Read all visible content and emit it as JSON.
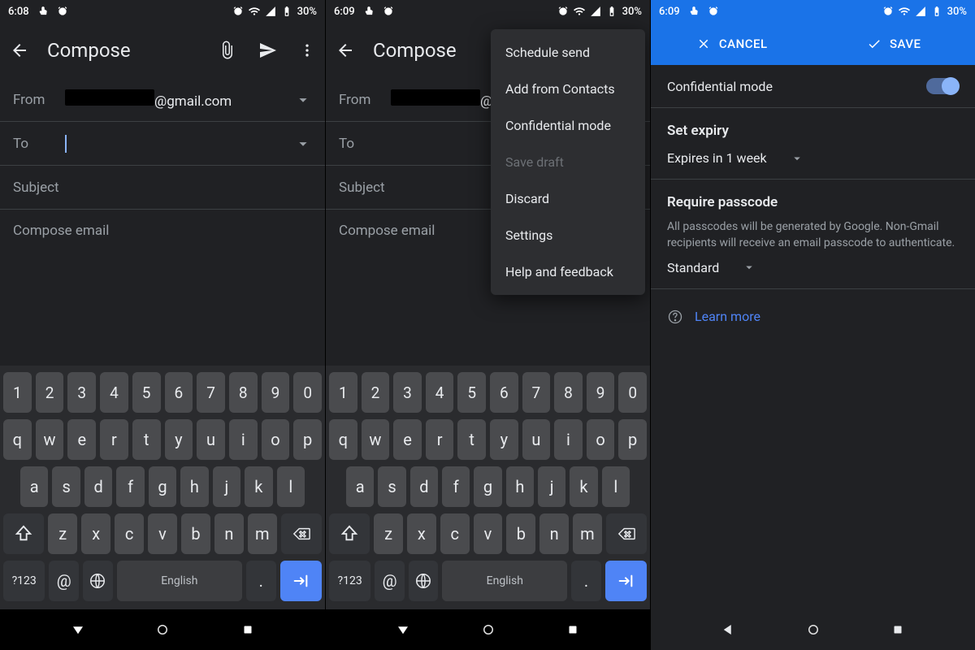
{
  "status": {
    "time_a": "6:08",
    "time_b": "6:09",
    "time_c": "6:09",
    "battery": "30%"
  },
  "compose": {
    "title": "Compose",
    "from_label": "From",
    "from_tail": "@gmail.com",
    "to_label": "To",
    "subject_placeholder": "Subject",
    "body_placeholder": "Compose email"
  },
  "menu": {
    "items": [
      "Schedule send",
      "Add from Contacts",
      "Confidential mode",
      "Save draft",
      "Discard",
      "Settings",
      "Help and feedback"
    ],
    "disabled_index": 3
  },
  "keyboard": {
    "row_num": [
      "1",
      "2",
      "3",
      "4",
      "5",
      "6",
      "7",
      "8",
      "9",
      "0"
    ],
    "row1": [
      "q",
      "w",
      "e",
      "r",
      "t",
      "y",
      "u",
      "i",
      "o",
      "p"
    ],
    "row2": [
      "a",
      "s",
      "d",
      "f",
      "g",
      "h",
      "j",
      "k",
      "l"
    ],
    "row3": [
      "z",
      "x",
      "c",
      "v",
      "b",
      "n",
      "m"
    ],
    "symbols_key": "?123",
    "at_key": "@",
    "space_label": "English",
    "dot_key": "."
  },
  "confidential": {
    "cancel": "CANCEL",
    "save": "SAVE",
    "title": "Confidential mode",
    "toggle_on": true,
    "expiry_title": "Set expiry",
    "expiry_value": "Expires in 1 week",
    "passcode_title": "Require passcode",
    "passcode_desc": "All passcodes will be generated by Google. Non-Gmail recipients will receive an email passcode to authenticate.",
    "passcode_value": "Standard",
    "learn_more": "Learn more"
  }
}
